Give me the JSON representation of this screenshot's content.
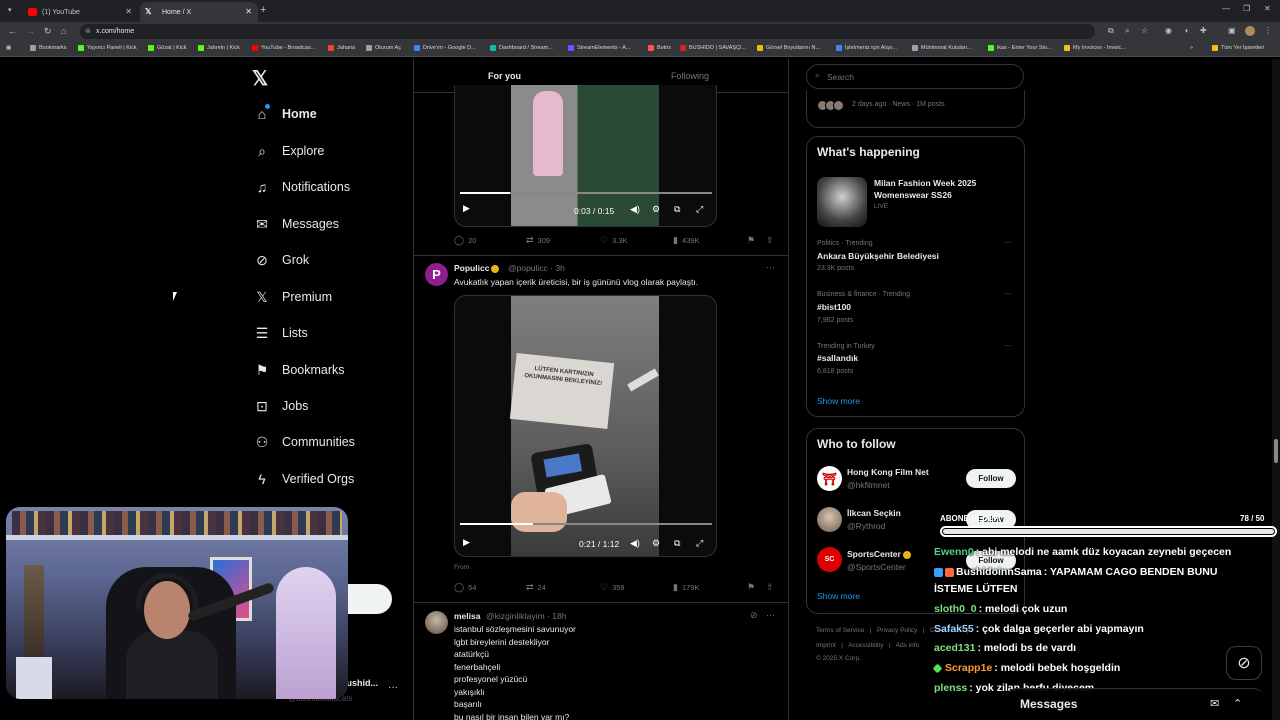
{
  "browser": {
    "tabs": [
      {
        "label": "(1) YouTube",
        "active": false,
        "color": "#ff0000"
      },
      {
        "label": "Home / X",
        "active": true,
        "color": "#ffffff"
      }
    ],
    "url": "x.com/home",
    "bookmarks": [
      "Bookmarks",
      "Yayıncı Paneli | Kick",
      "Gözat | Kick",
      "Jahrein | Kick",
      "YouTube - Broadcas...",
      "Jaharia",
      "Oturum Aç",
      "Drive'ım - Google D...",
      "Dashboard / Stream...",
      "StreamElements - A...",
      "Botrix",
      "BUSHIDO | SAVAŞÇI...",
      "Görsel Boyutlarını N...",
      "İşletmeniz için Alışv...",
      "Mühimmat Kutuları...",
      "ikas - Enter Your Sto...",
      "My Invoices - Invoic..."
    ],
    "all_bookmarks": "Tüm Yer İşaretleri"
  },
  "sidebar": {
    "items": [
      {
        "label": "Home",
        "icon": "home-icon"
      },
      {
        "label": "Explore",
        "icon": "search-icon"
      },
      {
        "label": "Notifications",
        "icon": "bell-icon"
      },
      {
        "label": "Messages",
        "icon": "mail-icon"
      },
      {
        "label": "Grok",
        "icon": "grok-icon"
      },
      {
        "label": "Premium",
        "icon": "x-icon"
      },
      {
        "label": "Lists",
        "icon": "list-icon"
      },
      {
        "label": "Bookmarks",
        "icon": "bookmark-icon"
      },
      {
        "label": "Jobs",
        "icon": "briefcase-icon"
      },
      {
        "label": "Communities",
        "icon": "people-icon"
      },
      {
        "label": "Verified Orgs",
        "icon": "lightning-icon"
      }
    ],
    "account_name": "Bushid...",
    "account_handle": "@bushidowildcats"
  },
  "feed": {
    "tab_for_you": "For you",
    "tab_following": "Following",
    "post1": {
      "video_time": "0:03 / 0:15",
      "progress": 0.2,
      "replies": "20",
      "reposts": "309",
      "likes": "3.3K",
      "views": "439K"
    },
    "post2": {
      "name": "Populicc",
      "handle": "@populicc · 3h",
      "text": "Avukatlık yapan içerik üreticisi, bir iş gününü vlog olarak paylaştı.",
      "sign_text": "LÜTFEN KARTINIZIN OKUNMASINI BEKLEYİNİZ!",
      "video_time": "0:21 / 1:12",
      "progress": 0.29,
      "from": "From .",
      "replies": "54",
      "reposts": "24",
      "likes": "359",
      "views": "179K"
    },
    "post3": {
      "name": "melisa",
      "handle": "@kizginliktayim · 18h",
      "lines": [
        "istanbul sözleşmesini savunuyor",
        "lgbt bireylerini destekliyor",
        "atatürkçü",
        "fenerbahçeli",
        "profesyonel yüzücü",
        "yakışıklı",
        "başarılı",
        "bu nasıl bir insan bilen var mı?"
      ]
    }
  },
  "right": {
    "search_placeholder": "Search",
    "news_meta": "2 days ago · News · 1M posts",
    "whats_happening": "What's happening",
    "fashion_title": "Milan Fashion Week 2025 Womenswear SS26",
    "fashion_live": "LIVE",
    "trends": [
      {
        "cat": "Politics · Trending",
        "title": "Ankara Büyükşehir Belediyesi",
        "posts": "23.3K posts"
      },
      {
        "cat": "Business & finance · Trending",
        "title": "#bist100",
        "posts": "7,962 posts"
      },
      {
        "cat": "Trending in Turkey",
        "title": "#sallandık",
        "posts": "6,818 posts"
      }
    ],
    "show_more": "Show more",
    "who_to_follow": "Who to follow",
    "follows": [
      {
        "name": "Hong Kong Film Net",
        "handle": "@hkfilmnet",
        "btn": "Follow"
      },
      {
        "name": "İlkcan Seçkin",
        "handle": "@Rythrod",
        "btn": "Follow"
      },
      {
        "name": "SportsCenter",
        "handle": "@SportsCenter",
        "btn": "Follow"
      }
    ],
    "show_more2": "Show more",
    "footer1": [
      "Terms of Service",
      "|",
      "Privacy Policy",
      "|",
      "Cookie Policy"
    ],
    "footer2": [
      "Imprint",
      "|",
      "Accessibility",
      "|",
      "Ads info"
    ],
    "footer3": "© 2025 X Corp."
  },
  "overlay": {
    "abone_label": "ABONE HEDEFİ",
    "abone_count": "78 / 50",
    "abone_progress": 1.0,
    "chat": [
      {
        "user": "Ewenn0",
        "color": "#4fd28a",
        "msg": ": abi melodi ne aamk düz koyacan zeynebi geçecen",
        "badge": ""
      },
      {
        "user": "BushidoinnSama",
        "color": "#ffffff",
        "msg": ": YAPAMAM CAGO BENDEN BUNU",
        "badge": "#3aa0ff",
        "badge2": "#ff6a3a"
      },
      {
        "user": "",
        "color": "#ffffff",
        "msg": "İSTEME LÜTFEN",
        "badge": ""
      },
      {
        "user": "sloth0_0",
        "color": "#7ee07e",
        "msg": ": melodi çok uzun",
        "badge": ""
      },
      {
        "user": "Safak55",
        "color": "#9fd3ff",
        "msg": ": çok dalga geçerler abi yapmayın",
        "badge": ""
      },
      {
        "user": "aced131",
        "color": "#7ee07e",
        "msg": ": melodi bs de vardı",
        "badge": ""
      },
      {
        "user": "Scrapp1e",
        "color": "#ff9a3a",
        "msg": ": melodi bebek hoşgeldin",
        "badge": "#53e05b"
      },
      {
        "user": "plenss",
        "color": "#7ee07e",
        "msg": ": yok zilan berfu diyecem",
        "badge": ""
      }
    ]
  },
  "messages_bar": "Messages"
}
